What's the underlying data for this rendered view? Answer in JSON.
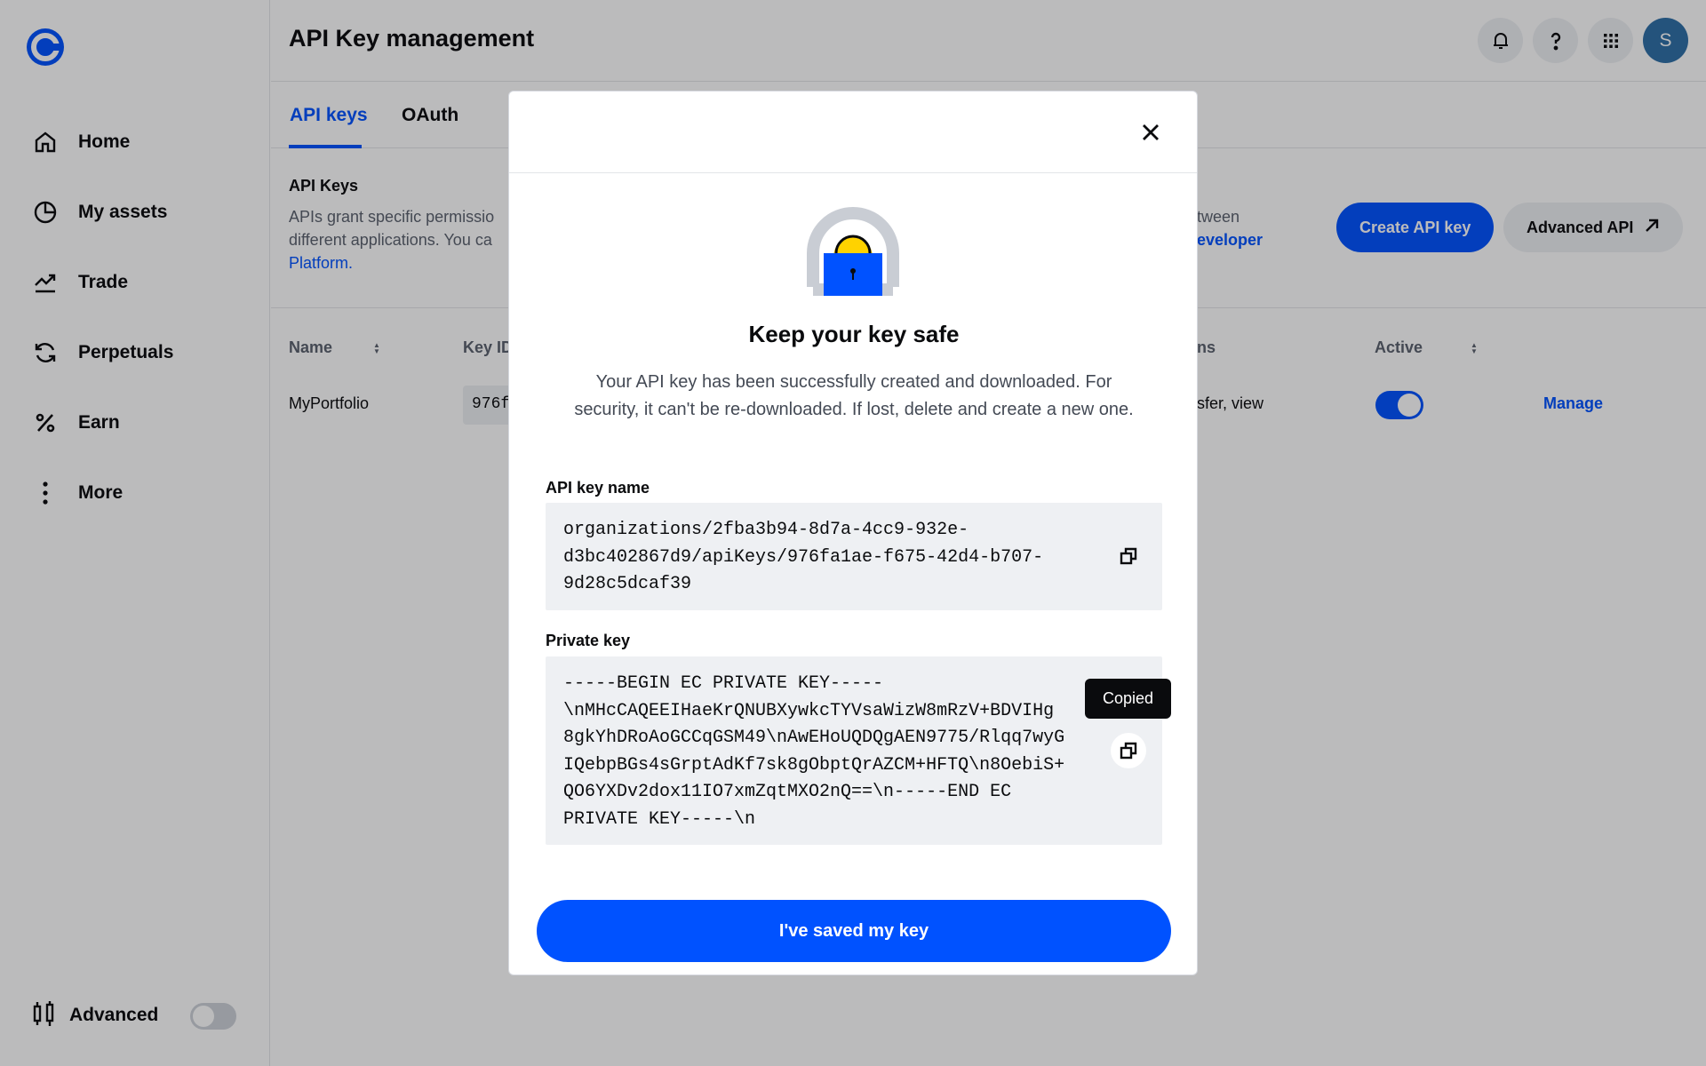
{
  "colors": {
    "accent": "#0052ff",
    "active_toggle": "#0052ff",
    "avatar": "#2e6fa7"
  },
  "sidebar": {
    "logo_icon": "coinbase-logo-icon",
    "items": [
      {
        "label": "Home",
        "icon": "home-icon"
      },
      {
        "label": "My assets",
        "icon": "pie-chart-icon"
      },
      {
        "label": "Trade",
        "icon": "trend-line-icon"
      },
      {
        "label": "Perpetuals",
        "icon": "refresh-cycle-icon"
      },
      {
        "label": "Earn",
        "icon": "percent-icon"
      },
      {
        "label": "More",
        "icon": "vertical-dots-icon"
      }
    ],
    "advanced": {
      "label": "Advanced",
      "icon": "candlestick-icon",
      "enabled": false
    }
  },
  "header": {
    "title": "API Key management",
    "icons": [
      "bell-icon",
      "help-icon",
      "app-grid-icon"
    ],
    "avatar_initial": "S"
  },
  "tabs": [
    {
      "label": "API keys",
      "active": true
    },
    {
      "label": "OAuth",
      "active": false
    }
  ],
  "api_section": {
    "title": "API Keys",
    "desc_line1": "APIs grant specific permissio",
    "desc_line2": "different applications. You ca",
    "desc_link": "Platform.",
    "desc_right_line1": "tween",
    "desc_right_link": "eveloper",
    "create_button": "Create API key",
    "advanced_button": "Advanced API",
    "advanced_icon": "arrow-up-right-icon"
  },
  "table": {
    "columns": {
      "name": "Name",
      "key_id": "Key ID",
      "permissions": "ns",
      "active": "Active"
    },
    "rows": [
      {
        "name": "MyPortfolio",
        "key_id": "976f",
        "permissions": "sfer, view",
        "active": true,
        "action": "Manage"
      }
    ]
  },
  "modal": {
    "close_icon": "close-icon",
    "lock_icon": "padlock-icon",
    "title": "Keep your key safe",
    "desc_line1": "Your API key has been successfully created and downloaded. For",
    "desc_line2": "security, it can't be re-downloaded. If lost, delete and create a new one.",
    "api_key_name": {
      "label": "API key name",
      "lines": [
        "organizations/2fba3b94-8d7a-4cc9-932e-",
        "d3bc402867d9/apiKeys/976fa1ae-f675-42d4-b707-",
        "9d28c5dcaf39"
      ]
    },
    "private_key": {
      "label": "Private key",
      "lines": [
        "-----BEGIN EC PRIVATE KEY-----",
        "\\nMHcCAQEEIHaeKrQNUBXywkcTYVsaWizW8mRzV+BDVIHg",
        "8gkYhDRoAoGCCqGSM49\\nAwEHoUQDQgAEN9775/Rlqq7wyG",
        "IQebpBGs4sGrptAdKf7sk8gObptQrAZCM+HFTQ\\n8OebiS+",
        "QO6YXDv2dox11IO7xmZqtMXO2nQ==\\n-----END EC",
        "PRIVATE KEY-----\\n"
      ]
    },
    "copy_icon": "copy-icon",
    "tooltip": "Copied",
    "confirm_button": "I've saved my key"
  }
}
